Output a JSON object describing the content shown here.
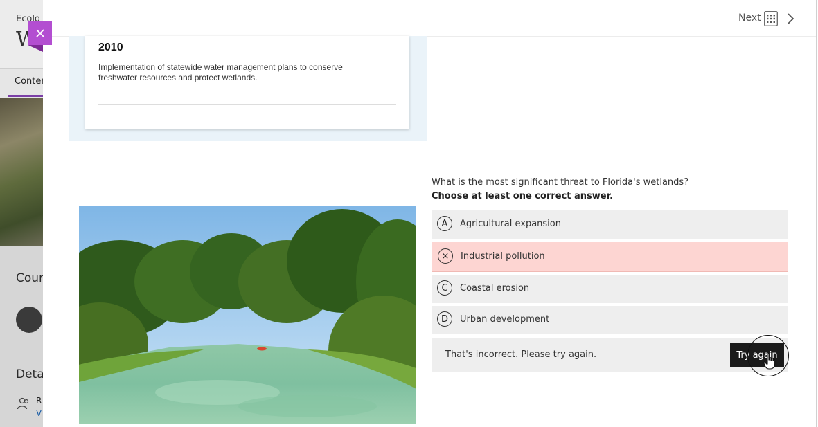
{
  "background": {
    "course_small": "Ecolo",
    "course_big": "W",
    "tab": "Conter",
    "section_1": "Cour",
    "section_2": "Deta",
    "peek_r": "R",
    "peek_v": "V"
  },
  "header": {
    "next_label": "Next"
  },
  "timeline_card": {
    "year": "2010",
    "description": "Implementation of statewide water management plans to conserve freshwater resources and protect wetlands."
  },
  "quiz": {
    "question": "What is the most significant threat to Florida's wetlands?",
    "instruction": "Choose at least one correct answer.",
    "options": [
      {
        "letter": "A",
        "label": "Agricultural expansion",
        "state": "default"
      },
      {
        "letter": "×",
        "label": "Industrial pollution",
        "state": "incorrect"
      },
      {
        "letter": "C",
        "label": "Coastal erosion",
        "state": "default"
      },
      {
        "letter": "D",
        "label": "Urban development",
        "state": "default"
      }
    ],
    "feedback": "That's incorrect. Please try again.",
    "try_again_label": "Try again"
  },
  "colors": {
    "accent_purple": "#b34ed1",
    "incorrect_bg": "#fdd5d2",
    "option_bg": "#eeeeee",
    "button_dark": "#1a1a1a"
  },
  "icons": [
    "close-icon",
    "grid-icon",
    "chevron-right-icon",
    "incorrect-x-icon",
    "people-icon",
    "hand-cursor-icon"
  ]
}
